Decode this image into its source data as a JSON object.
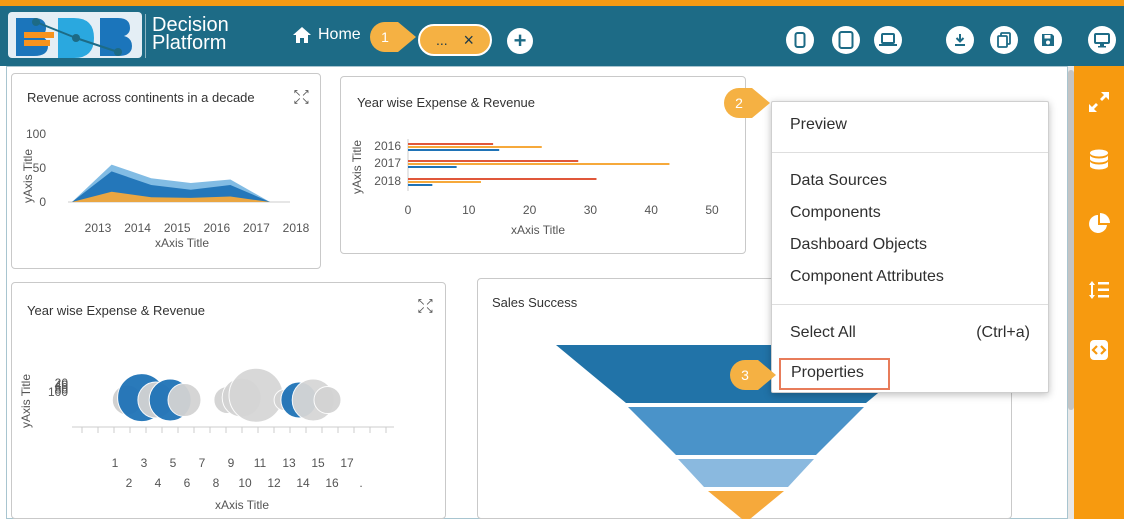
{
  "header": {
    "platform_line1": "Decision",
    "platform_line2": "Platform",
    "home_label": "Home",
    "tab_label": "...",
    "tab_close": "×",
    "add_label": "+"
  },
  "callouts": [
    "1",
    "2",
    "3"
  ],
  "charts": {
    "revenue": {
      "title": "Revenue across continents in a decade"
    },
    "expense_bar": {
      "title": "Year wise Expense & Revenue"
    },
    "expense_bubble": {
      "title": "Year wise Expense & Revenue"
    },
    "sales": {
      "title": "Sales Success"
    }
  },
  "chart_data": [
    {
      "type": "area",
      "title": "Revenue across continents in a decade",
      "xlabel": "xAxis Title",
      "ylabel": "yAxis Title",
      "categories": [
        "2013",
        "2014",
        "2015",
        "2016",
        "2017",
        "2018"
      ],
      "y_ticks": [
        "0",
        "50",
        "100"
      ],
      "ylim": [
        0,
        100
      ],
      "series": [
        {
          "values": [
            0,
            55,
            35,
            28,
            33,
            0
          ],
          "color": "#7bb8e3"
        },
        {
          "values": [
            0,
            45,
            25,
            18,
            25,
            0
          ],
          "color": "#1f73b7"
        },
        {
          "values": [
            0,
            15,
            7,
            6,
            8,
            0
          ],
          "color": "#f6a93b"
        }
      ]
    },
    {
      "type": "bar",
      "orientation": "horizontal",
      "title": "Year wise Expense & Revenue",
      "xlabel": "xAxis Title",
      "ylabel": "yAxis Title",
      "categories": [
        "2016",
        "2017",
        "2018"
      ],
      "x_ticks": [
        "0",
        "10",
        "20",
        "30",
        "40",
        "50"
      ],
      "xlim": [
        0,
        50
      ],
      "series": [
        {
          "values": [
            14,
            28,
            31
          ],
          "color": "#e0573a"
        },
        {
          "values": [
            22,
            43,
            12
          ],
          "color": "#f6a93b"
        },
        {
          "values": [
            15,
            8,
            4
          ],
          "color": "#1f73b7"
        }
      ]
    },
    {
      "type": "scatter",
      "subtype": "bubble",
      "title": "Year wise Expense & Revenue",
      "xlabel": "xAxis Title",
      "ylabel": "yAxis Title",
      "y_ticks": [
        "20",
        "40",
        "60",
        "80",
        "100"
      ],
      "x_ticks_row1": [
        "1",
        "3",
        "5",
        "7",
        "9",
        "11",
        "13",
        "15",
        "17"
      ],
      "x_ticks_row2": [
        "2",
        "4",
        "6",
        "8",
        "10",
        "12",
        "14",
        "16",
        "."
      ],
      "points": [
        {
          "x": 2,
          "y": 60,
          "size": 10,
          "color": "#cfcfcf"
        },
        {
          "x": 3,
          "y": 62,
          "size": 16,
          "color": "#1f73b7"
        },
        {
          "x": 4,
          "y": 60,
          "size": 12,
          "color": "#d3d3d3"
        },
        {
          "x": 5,
          "y": 60,
          "size": 14,
          "color": "#1f73b7"
        },
        {
          "x": 6,
          "y": 60,
          "size": 11,
          "color": "#d3d3d3"
        },
        {
          "x": 9,
          "y": 60,
          "size": 9,
          "color": "#d3d3d3"
        },
        {
          "x": 10,
          "y": 62,
          "size": 13,
          "color": "#d3d3d3"
        },
        {
          "x": 11,
          "y": 64,
          "size": 18,
          "color": "#d6d6d6"
        },
        {
          "x": 13,
          "y": 60,
          "size": 7,
          "color": "#d3d3d3"
        },
        {
          "x": 14,
          "y": 60,
          "size": 12,
          "color": "#1f73b7"
        },
        {
          "x": 15,
          "y": 60,
          "size": 14,
          "color": "#d6d6d6"
        },
        {
          "x": 16,
          "y": 60,
          "size": 9,
          "color": "#d3d3d3"
        }
      ]
    },
    {
      "type": "funnel",
      "title": "Sales Success",
      "stages": [
        {
          "color": "#2173a8"
        },
        {
          "color": "#4a93c9"
        },
        {
          "color": "#8ab9df"
        },
        {
          "color": "#f6a93b"
        }
      ]
    }
  ],
  "context_menu": {
    "preview": "Preview",
    "data_sources": "Data Sources",
    "components": "Components",
    "dashboard_objects": "Dashboard Objects",
    "component_attributes": "Component Attributes",
    "select_all": "Select All",
    "select_all_shortcut": "(Ctrl+a)",
    "properties": "Properties"
  },
  "colors": {
    "header_bg": "#1d6b86",
    "accent_orange": "#f79a0f",
    "callout": "#f5b143",
    "properties_highlight": "#e87c5a"
  },
  "icons": {
    "header_buttons": [
      "mobile-icon",
      "tablet-icon",
      "laptop-icon",
      "download-icon",
      "copy-icon",
      "save-icon",
      "monitor-icon"
    ],
    "sidebar": [
      "expand-icon",
      "database-icon",
      "pie-chart-icon",
      "line-height-icon",
      "code-icon"
    ]
  }
}
